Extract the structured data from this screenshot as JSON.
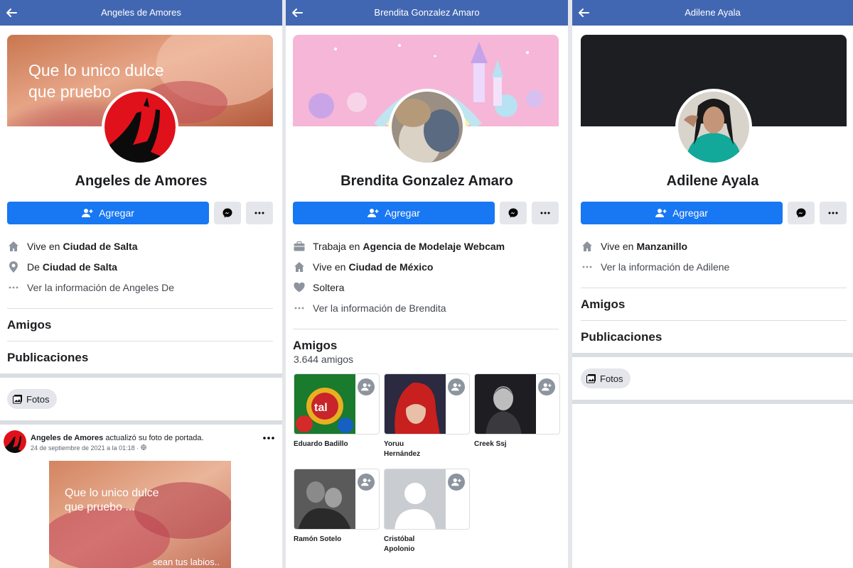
{
  "profiles": [
    {
      "header_title": "Angeles de Amores",
      "cover_text": [
        "Que lo unico dulce",
        "que pruebo"
      ],
      "name": "Angeles de Amores",
      "add_label": "Agregar",
      "info": [
        {
          "icon": "home-icon",
          "prefix": "Vive en",
          "strong": "Ciudad de Salta"
        },
        {
          "icon": "location-pin-icon",
          "prefix": "De",
          "strong": "Ciudad de Salta"
        },
        {
          "icon": "more-dots-icon",
          "prefix": "Ver la información de Angeles De",
          "strong": ""
        }
      ],
      "friends_heading": "Amigos",
      "posts_heading": "Publicaciones",
      "photos_label": "Fotos",
      "post": {
        "author": "Angeles de Amores",
        "action": "actualizó su foto de portada.",
        "date": "24 de septiembre de 2021 a la 01:18 ·",
        "image_text": [
          "Que lo unico dulce",
          "que pruebo ...",
          "sean tus labios.."
        ]
      }
    },
    {
      "header_title": "Brendita Gonzalez Amaro",
      "name": "Brendita Gonzalez Amaro",
      "add_label": "Agregar",
      "info": [
        {
          "icon": "briefcase-icon",
          "prefix": "Trabaja en",
          "strong": "Agencia de Modelaje Webcam"
        },
        {
          "icon": "home-icon",
          "prefix": "Vive en",
          "strong": "Ciudad de México"
        },
        {
          "icon": "heart-icon",
          "prefix": "Soltera",
          "strong": ""
        },
        {
          "icon": "more-dots-icon",
          "prefix": "Ver la información de Brendita",
          "strong": ""
        }
      ],
      "friends_heading": "Amigos",
      "friends_count": "3.644 amigos",
      "friends": [
        {
          "name": "Eduardo Badillo",
          "photo_text": "tal"
        },
        {
          "name": "Yoruu Hernández"
        },
        {
          "name": "Creek Ssj"
        },
        {
          "name": "Ramón Sotelo"
        },
        {
          "name": "Cristóbal Apolonio"
        }
      ]
    },
    {
      "header_title": "Adilene Ayala",
      "name": "Adilene Ayala",
      "add_label": "Agregar",
      "info": [
        {
          "icon": "home-icon",
          "prefix": "Vive en",
          "strong": "Manzanillo"
        },
        {
          "icon": "more-dots-icon",
          "prefix": "Ver la información de Adilene",
          "strong": ""
        }
      ],
      "friends_heading": "Amigos",
      "posts_heading": "Publicaciones",
      "photos_label": "Fotos"
    }
  ],
  "colors": {
    "header_bg": "#4267b2",
    "primary_button": "#1877f2",
    "secondary_button": "#e4e6eb",
    "divider": "#dadde1"
  }
}
